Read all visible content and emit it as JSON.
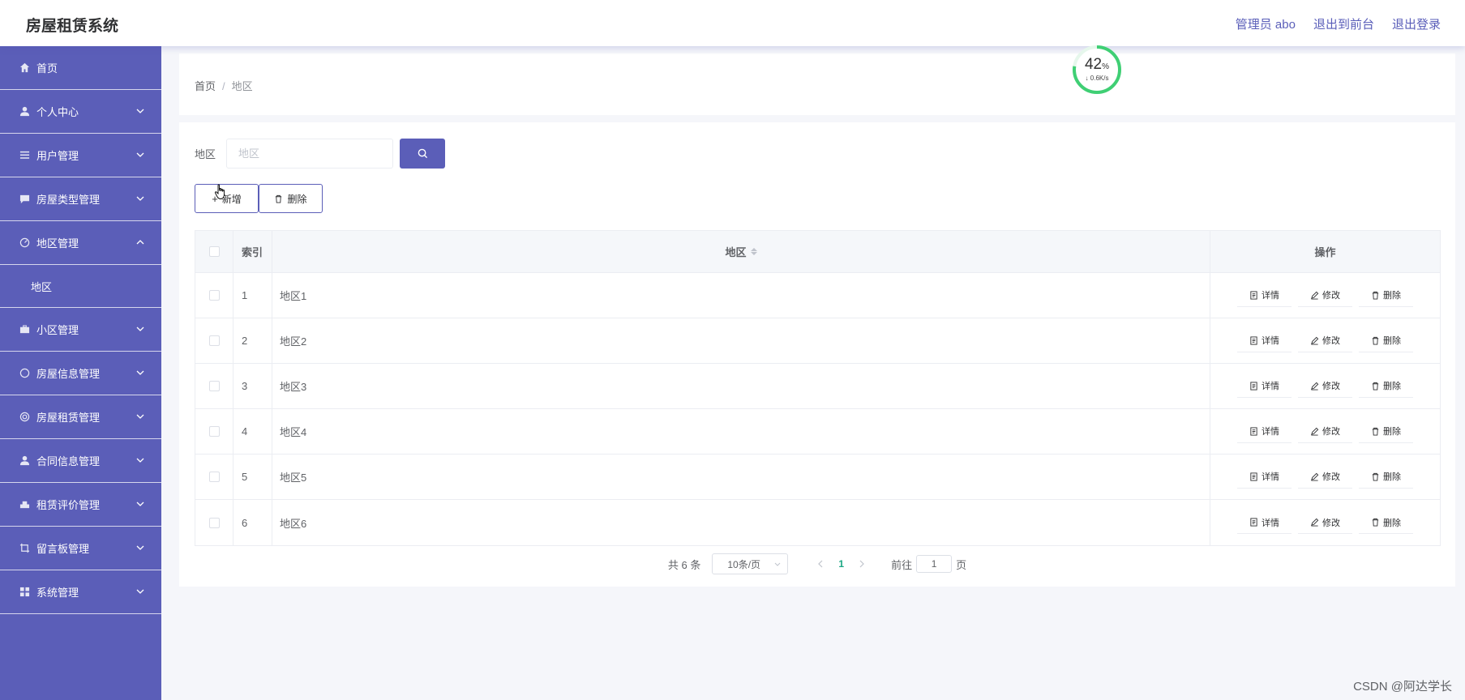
{
  "header": {
    "app_title": "房屋租赁系统",
    "admin_label": "管理员 abo",
    "back_to_front": "退出到前台",
    "logout": "退出登录"
  },
  "sidebar": {
    "items": [
      {
        "label": "首页",
        "icon": "home-icon"
      },
      {
        "label": "个人中心",
        "icon": "user-icon"
      },
      {
        "label": "用户管理",
        "icon": "list-icon"
      },
      {
        "label": "房屋类型管理",
        "icon": "chat-icon"
      },
      {
        "label": "地区管理",
        "icon": "gauge-icon",
        "expanded": true,
        "children": [
          {
            "label": "地区"
          }
        ]
      },
      {
        "label": "小区管理",
        "icon": "briefcase-icon"
      },
      {
        "label": "房屋信息管理",
        "icon": "compass-icon"
      },
      {
        "label": "房屋租赁管理",
        "icon": "target-icon"
      },
      {
        "label": "合同信息管理",
        "icon": "person-icon"
      },
      {
        "label": "租赁评价管理",
        "icon": "stamp-icon"
      },
      {
        "label": "留言板管理",
        "icon": "crop-icon"
      },
      {
        "label": "系统管理",
        "icon": "grid-icon"
      }
    ]
  },
  "breadcrumb": {
    "home": "首页",
    "separator": "/",
    "current": "地区"
  },
  "meter": {
    "percent": "42",
    "percent_unit": "%",
    "speed": "0.6K/s"
  },
  "search": {
    "label": "地区",
    "placeholder": "地区",
    "value": ""
  },
  "actions": {
    "add_label": "新增",
    "delete_label": "删除"
  },
  "table": {
    "headers": {
      "index": "索引",
      "area": "地区",
      "ops": "操作"
    },
    "rows": [
      {
        "index": "1",
        "area": "地区1"
      },
      {
        "index": "2",
        "area": "地区2"
      },
      {
        "index": "3",
        "area": "地区3"
      },
      {
        "index": "4",
        "area": "地区4"
      },
      {
        "index": "5",
        "area": "地区5"
      },
      {
        "index": "6",
        "area": "地区6"
      }
    ],
    "op_labels": {
      "detail": "详情",
      "edit": "修改",
      "delete": "删除"
    }
  },
  "pagination": {
    "total_text": "共 6 条",
    "page_size": "10条/页",
    "current_page": "1",
    "goto_prefix": "前往",
    "goto_value": "1",
    "goto_suffix": "页"
  },
  "watermark": "CSDN @阿达学长",
  "colors": {
    "primary": "#5b5eb8",
    "meter_ring": "#3fcf74",
    "active_page": "#1ba784"
  }
}
